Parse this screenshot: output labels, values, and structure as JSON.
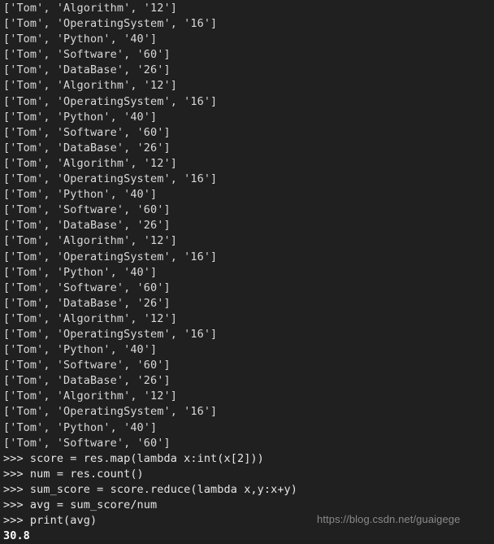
{
  "terminal": {
    "background_color": "#202020",
    "text_color": "#d9d9d9",
    "prompt": ">>>",
    "data_rows": [
      "['Tom', 'Algorithm', '12']",
      "['Tom', 'OperatingSystem', '16']",
      "['Tom', 'Python', '40']",
      "['Tom', 'Software', '60']",
      "['Tom', 'DataBase', '26']",
      "['Tom', 'Algorithm', '12']",
      "['Tom', 'OperatingSystem', '16']",
      "['Tom', 'Python', '40']",
      "['Tom', 'Software', '60']",
      "['Tom', 'DataBase', '26']",
      "['Tom', 'Algorithm', '12']",
      "['Tom', 'OperatingSystem', '16']",
      "['Tom', 'Python', '40']",
      "['Tom', 'Software', '60']",
      "['Tom', 'DataBase', '26']",
      "['Tom', 'Algorithm', '12']",
      "['Tom', 'OperatingSystem', '16']",
      "['Tom', 'Python', '40']",
      "['Tom', 'Software', '60']",
      "['Tom', 'DataBase', '26']",
      "['Tom', 'Algorithm', '12']",
      "['Tom', 'OperatingSystem', '16']",
      "['Tom', 'Python', '40']",
      "['Tom', 'Software', '60']",
      "['Tom', 'DataBase', '26']",
      "['Tom', 'Algorithm', '12']",
      "['Tom', 'OperatingSystem', '16']",
      "['Tom', 'Python', '40']",
      "['Tom', 'Software', '60']"
    ],
    "command_lines": [
      ">>> score = res.map(lambda x:int(x[2]))",
      ">>> num = res.count()",
      ">>> sum_score = score.reduce(lambda x,y:x+y)",
      ">>> avg = sum_score/num",
      ">>> print(avg)"
    ],
    "output_lines": [
      "30.8"
    ]
  },
  "watermark": {
    "text": "https://blog.csdn.net/guaigege"
  }
}
